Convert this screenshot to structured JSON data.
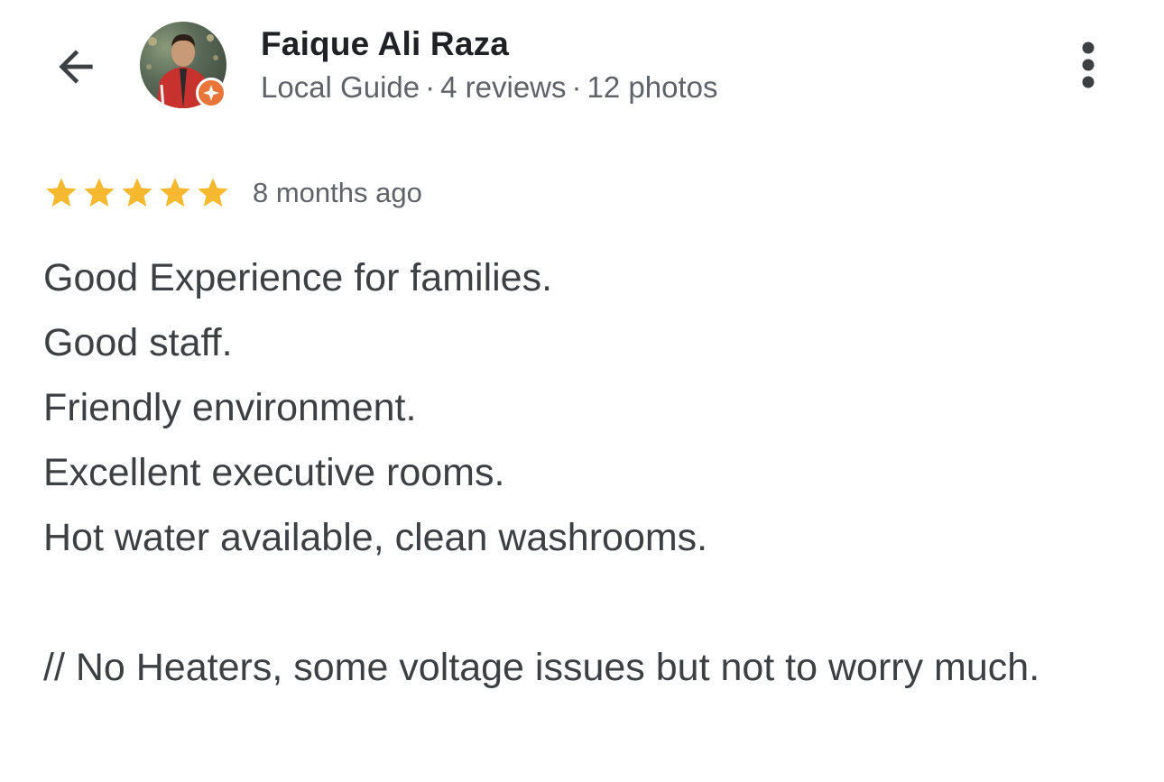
{
  "header": {
    "back_icon": "arrow-back-icon",
    "reviewer_name": "Faique Ali Raza",
    "reviewer_role": "Local Guide",
    "reviews_count": "4 reviews",
    "photos_count": "12 photos",
    "separator": "·",
    "badge_icon": "local-guide-star-icon",
    "badge_color": "#e8753a",
    "more_icon": "more-vert-icon"
  },
  "review": {
    "rating": 5,
    "max_rating": 5,
    "star_color": "#f5b82e",
    "time_ago": "8 months ago",
    "lines": [
      "Good Experience for families.",
      "Good staff.",
      "Friendly environment.",
      "Excellent executive rooms.",
      "Hot water available, clean washrooms."
    ],
    "note": "// No Heaters, some voltage issues but not to worry much."
  }
}
